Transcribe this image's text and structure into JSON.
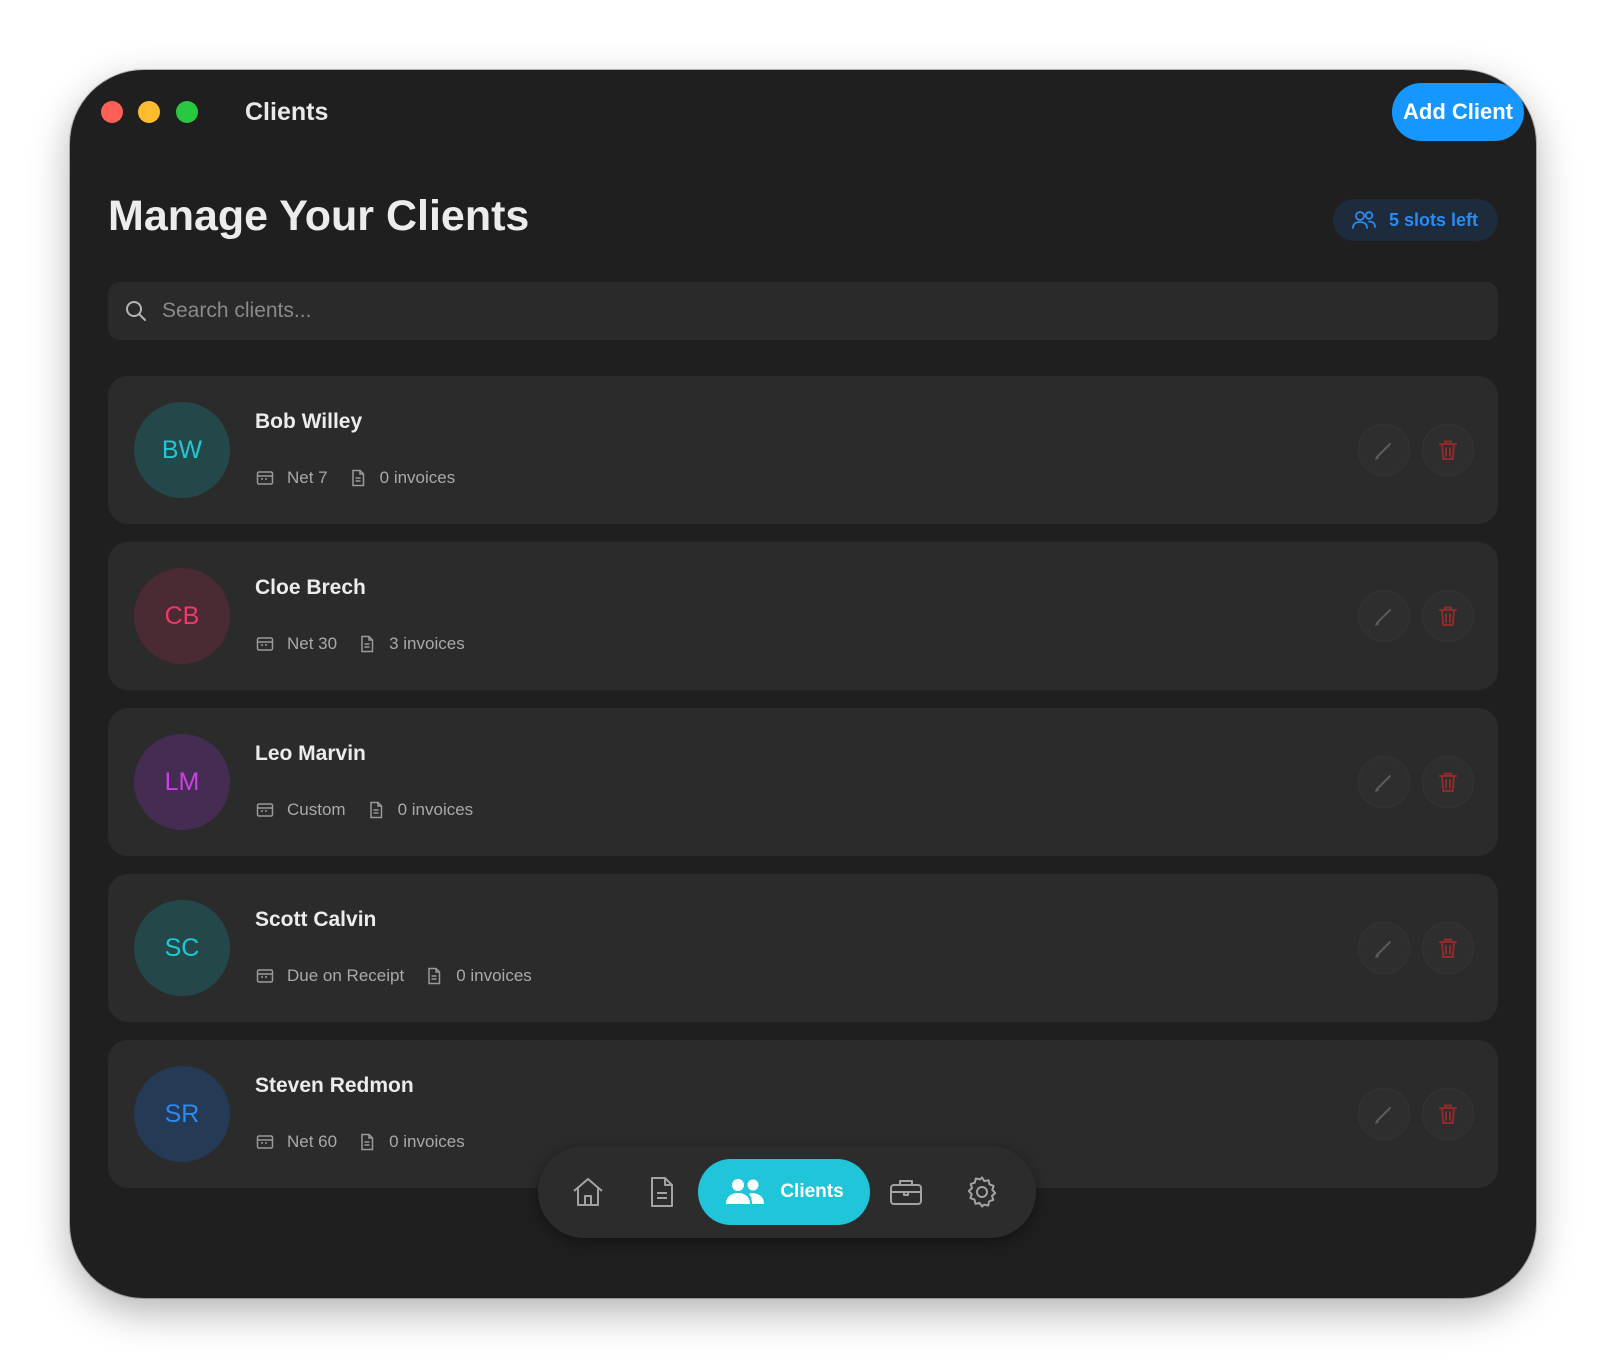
{
  "window": {
    "title": "Clients"
  },
  "header": {
    "add_client_label": "Add Client",
    "page_title": "Manage Your Clients",
    "slots_badge": "5 slots left"
  },
  "search": {
    "placeholder": "Search clients...",
    "value": ""
  },
  "clients": [
    {
      "initials": "BW",
      "name": "Bob Willey",
      "terms": "Net 7",
      "invoices": "0 invoices",
      "avatar_bg": "#24484a",
      "avatar_fg": "#1fc8d4"
    },
    {
      "initials": "CB",
      "name": "Cloe Brech",
      "terms": "Net 30",
      "invoices": "3 invoices",
      "avatar_bg": "#4a2a33",
      "avatar_fg": "#f0386a"
    },
    {
      "initials": "LM",
      "name": "Leo Marvin",
      "terms": "Custom",
      "invoices": "0 invoices",
      "avatar_bg": "#452c53",
      "avatar_fg": "#cf3fe6"
    },
    {
      "initials": "SC",
      "name": "Scott Calvin",
      "terms": "Due on Receipt",
      "invoices": "0 invoices",
      "avatar_bg": "#24484a",
      "avatar_fg": "#1fc8d4"
    },
    {
      "initials": "SR",
      "name": "Steven Redmon",
      "terms": "Net 60",
      "invoices": "0 invoices",
      "avatar_bg": "#243a55",
      "avatar_fg": "#2a8bf0"
    }
  ],
  "nav": {
    "items": [
      {
        "icon": "home-icon"
      },
      {
        "icon": "document-icon"
      },
      {
        "icon": "users-icon",
        "label": "Clients",
        "active": true
      },
      {
        "icon": "briefcase-icon"
      },
      {
        "icon": "gear-icon"
      }
    ]
  },
  "colors": {
    "accent": "#1597ff",
    "nav_active": "#21c5da",
    "window_bg": "#1f1f1f",
    "card_bg": "#2b2b2b",
    "delete": "#8f2b2b"
  }
}
